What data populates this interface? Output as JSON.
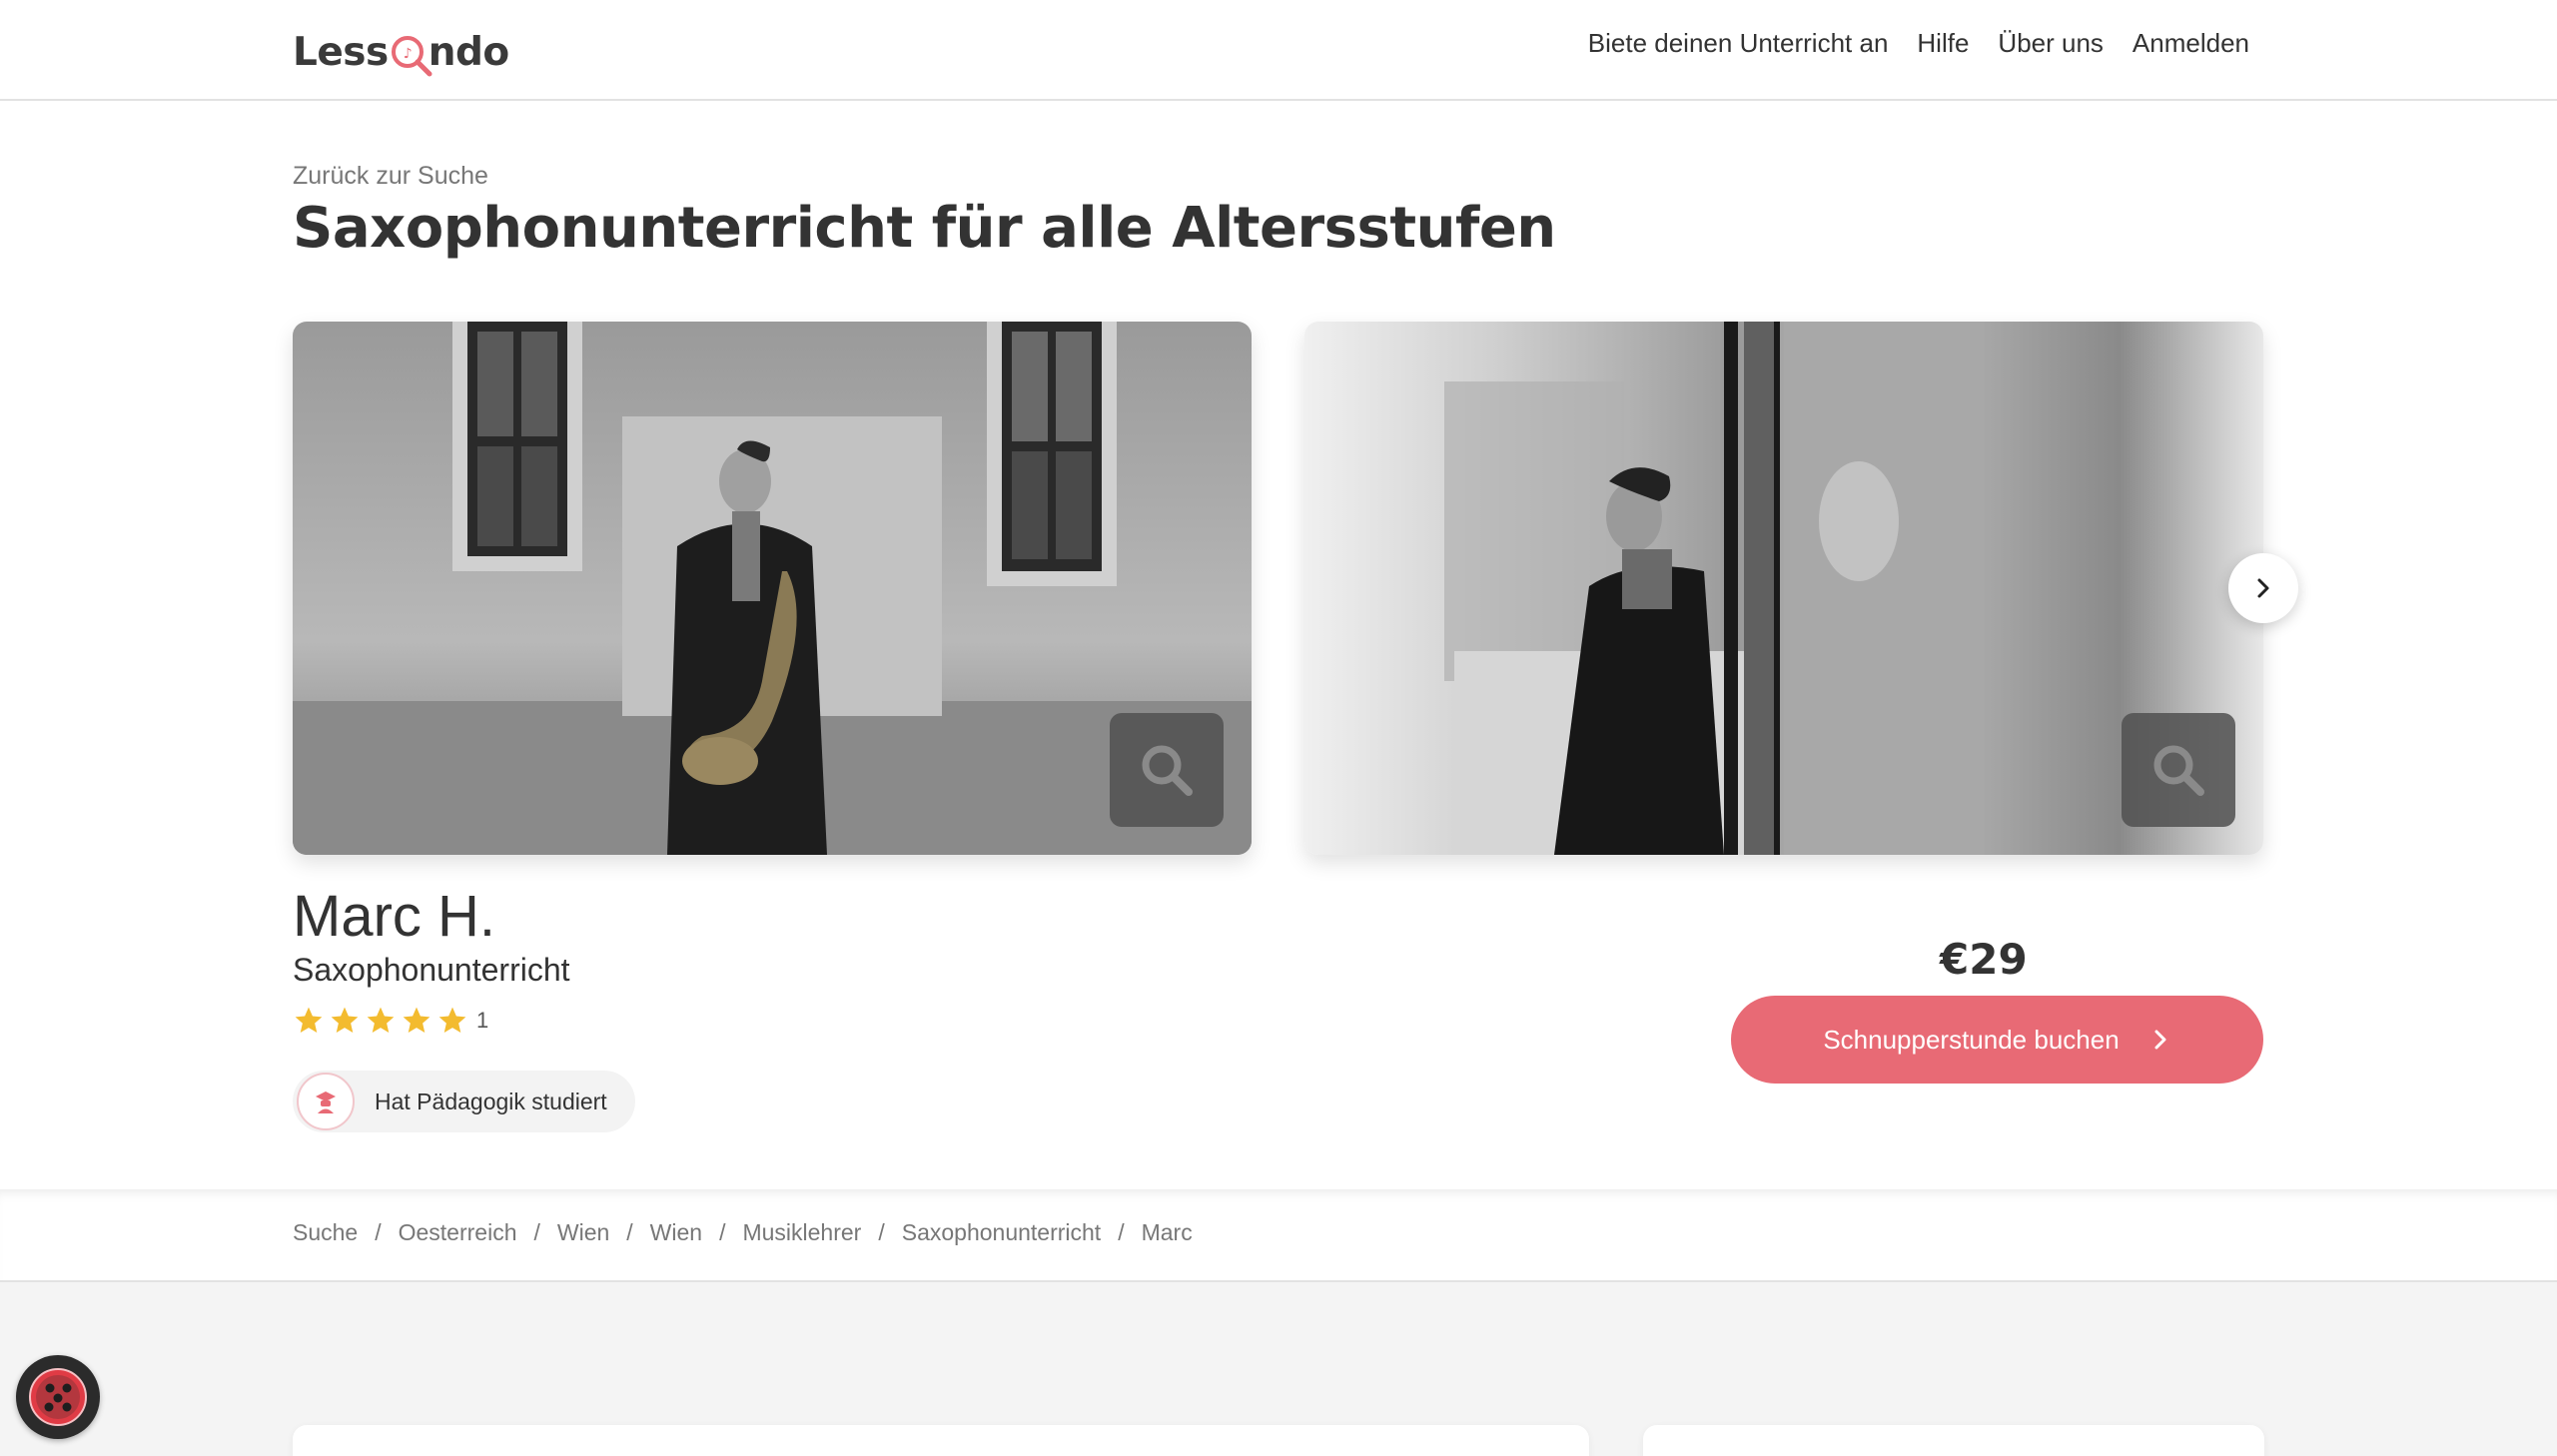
{
  "header": {
    "logo_text_left": "Less",
    "logo_text_right": "ndo",
    "nav": [
      {
        "label": "Biete deinen Unterricht an"
      },
      {
        "label": "Hilfe"
      },
      {
        "label": "Über uns"
      },
      {
        "label": "Anmelden"
      }
    ]
  },
  "hero": {
    "back_link": "Zurück zur Suche",
    "title": "Saxophonunterricht für alle Altersstufen"
  },
  "teacher": {
    "name": "Marc H.",
    "subject": "Saxophonunterricht",
    "rating_stars": 5,
    "rating_count": "1",
    "badge": "Hat Pädagogik studiert"
  },
  "booking": {
    "price": "€29",
    "button_label": "Schnupperstunde buchen"
  },
  "breadcrumb": [
    "Suche",
    "Oesterreich",
    "Wien",
    "Wien",
    "Musiklehrer",
    "Saxophonunterricht",
    "Marc"
  ],
  "colors": {
    "accent": "#e86a75",
    "star": "#f3bb2f",
    "text": "#333333",
    "muted": "#777777"
  },
  "icons": {
    "zoom": "magnifier-icon",
    "next": "chevron-right-icon",
    "badge": "graduate-icon",
    "cookie": "cookie-icon"
  }
}
